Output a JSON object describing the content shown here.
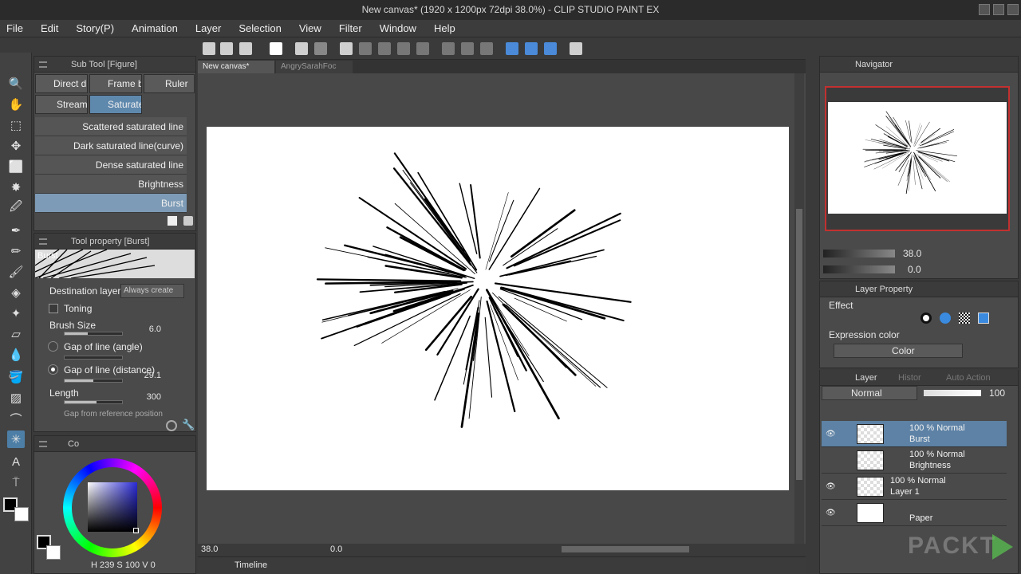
{
  "window": {
    "title": "New canvas* (1920 x 1200px 72dpi 38.0%) - CLIP STUDIO PAINT EX"
  },
  "menu": [
    "File",
    "Edit",
    "Story(P)",
    "Animation",
    "Layer",
    "Selection",
    "View",
    "Filter",
    "Window",
    "Help"
  ],
  "canvas_tabs": [
    "New canvas*",
    "AngrySarahFoc"
  ],
  "subtool": {
    "header": "Sub Tool [Figure]",
    "tabs": [
      "Direct d",
      "Frame b",
      "Ruler",
      "Stream",
      "Saturate"
    ],
    "brushes": [
      "Scattered saturated line",
      "Dark saturated line(curve)",
      "Dense saturated line",
      "Brightness",
      "Burst"
    ]
  },
  "tool_property": {
    "header": "Tool property [Burst]",
    "preview_label": "Burst",
    "destination_label": "Destination layer",
    "destination_value": "Always create",
    "toning_label": "Toning",
    "brush_size_label": "Brush Size",
    "brush_size_value": "6.0",
    "gap_angle_label": "Gap of line (angle)",
    "gap_distance_label": "Gap of line (distance)",
    "gap_distance_value": "29.1",
    "length_label": "Length",
    "length_value": "300",
    "gap_ref_label": "Gap from reference position"
  },
  "color": {
    "tab_label": "Co",
    "h": "239",
    "s": "100",
    "v": "0",
    "main_color": "#000000",
    "sub_color": "#ffffff",
    "box_color": "#2a2ad8"
  },
  "navigator": {
    "tab": "Navigator",
    "zoom": "38.0",
    "rotate": "0.0"
  },
  "layer_property": {
    "tab": "Layer Property",
    "effect_label": "Effect",
    "expression_label": "Expression color",
    "expression_value": "Color"
  },
  "layers_panel": {
    "tabs": [
      "Layer",
      "Histor",
      "Auto Action"
    ],
    "blend": "Normal",
    "opacity": "100",
    "layers": [
      {
        "line1": "100 %  Normal",
        "line2": "Burst"
      },
      {
        "line1": "100 %  Normal",
        "line2": "Brightness"
      },
      {
        "line1": "100 %  Normal",
        "line2": "Layer 1"
      },
      {
        "line1": "",
        "line2": "Paper"
      }
    ]
  },
  "status": {
    "zoom": "38.0",
    "angle": "0.0",
    "timeline_label": "Timeline"
  },
  "watermark": "PACKT"
}
